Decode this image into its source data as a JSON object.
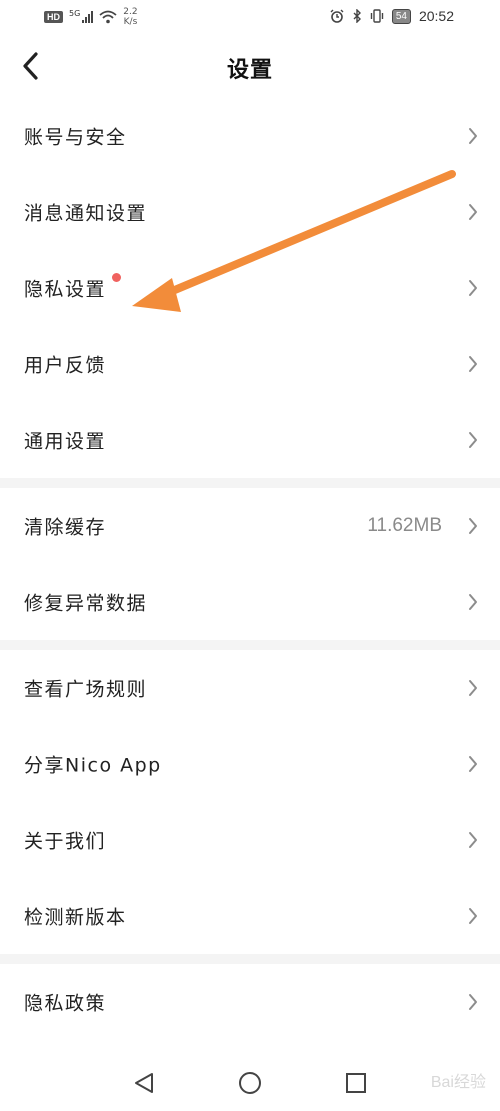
{
  "status_bar": {
    "hd": "HD",
    "network": "5G",
    "speed_value": "2.2",
    "speed_unit": "K/s",
    "battery": "54",
    "time": "20:52"
  },
  "header": {
    "title": "设置"
  },
  "groups": [
    {
      "items": [
        {
          "label": "账号与安全",
          "value": ""
        },
        {
          "label": "消息通知设置",
          "value": ""
        },
        {
          "label": "隐私设置",
          "value": "",
          "badge_dot": true
        },
        {
          "label": "用户反馈",
          "value": ""
        },
        {
          "label": "通用设置",
          "value": ""
        }
      ]
    },
    {
      "items": [
        {
          "label": "清除缓存",
          "value": "11.62MB"
        },
        {
          "label": "修复异常数据",
          "value": ""
        }
      ]
    },
    {
      "items": [
        {
          "label": "查看广场规则",
          "value": ""
        },
        {
          "label": "分享Nico App",
          "value": ""
        },
        {
          "label": "关于我们",
          "value": ""
        },
        {
          "label": "检测新版本",
          "value": ""
        }
      ]
    },
    {
      "items": [
        {
          "label": "隐私政策",
          "value": ""
        }
      ]
    }
  ],
  "colors": {
    "badge_dot": "#f0625f",
    "annotation_arrow": "#f28c3a",
    "divider": "#f4f4f4"
  },
  "icons": {
    "back": "chevron-left-icon",
    "row": "chevron-right-icon",
    "nav_back": "triangle-back-icon",
    "nav_home": "circle-home-icon",
    "nav_recent": "square-recent-icon"
  },
  "watermark": "Bai经验"
}
